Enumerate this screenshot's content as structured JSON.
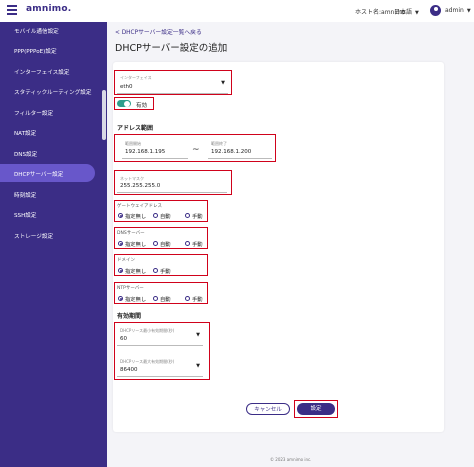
{
  "header": {
    "logo_text": "amnimo.",
    "host_label": "ホスト名:amnimo",
    "language": "日本語",
    "user": "admin"
  },
  "sidebar": {
    "items": [
      {
        "label": "モバイル通信設定"
      },
      {
        "label": "PPP(PPPoE)設定"
      },
      {
        "label": "インターフェイス設定"
      },
      {
        "label": "スタティックルーティング設定"
      },
      {
        "label": "フィルター設定"
      },
      {
        "label": "NAT設定"
      },
      {
        "label": "DNS設定"
      },
      {
        "label": "DHCPサーバー設定",
        "active": true
      },
      {
        "label": "時刻設定"
      },
      {
        "label": "SSH設定"
      },
      {
        "label": "ストレージ設定"
      }
    ]
  },
  "breadcrumb": "< DHCPサーバー設定一覧へ戻る",
  "page_title": "DHCPサーバー設定の追加",
  "form": {
    "interface": {
      "label": "インターフェイス",
      "value": "eth0"
    },
    "enabled_label": "有効",
    "address_range_title": "アドレス範囲",
    "range_start": {
      "label": "範囲開始",
      "value": "192.168.1.195"
    },
    "range_tilde": "~",
    "range_end": {
      "label": "範囲終了",
      "value": "192.168.1.200"
    },
    "netmask": {
      "label": "ネットマスク",
      "value": "255.255.255.0"
    },
    "gateway": {
      "label": "ゲートウェイアドレス",
      "options": [
        "指定無し",
        "自動",
        "手動"
      ],
      "selected": "指定無し"
    },
    "dns_server": {
      "label": "DNSサーバー",
      "options": [
        "指定無し",
        "自動",
        "手動"
      ],
      "selected": "指定無し"
    },
    "domain": {
      "label": "ドメイン",
      "options": [
        "指定無し",
        "手動"
      ],
      "selected": "指定無し"
    },
    "ntp_server": {
      "label": "NTPサーバー",
      "options": [
        "指定無し",
        "自動",
        "手動"
      ],
      "selected": "指定無し"
    },
    "lease_title": "有効期間",
    "lease_min": {
      "label": "DHCPリース最小有効期間(秒)",
      "value": "60"
    },
    "lease_max": {
      "label": "DHCPリース最大有効期間(秒)",
      "value": "86400"
    }
  },
  "buttons": {
    "cancel": "キャンセル",
    "save": "設定"
  },
  "footer": "© 2023 amnimo inc.",
  "colors": {
    "sidebar": "#3b2d86",
    "sidebar_active": "#6a5acd",
    "toggle_on": "#2e9e8c",
    "highlight": "#d0021b"
  }
}
